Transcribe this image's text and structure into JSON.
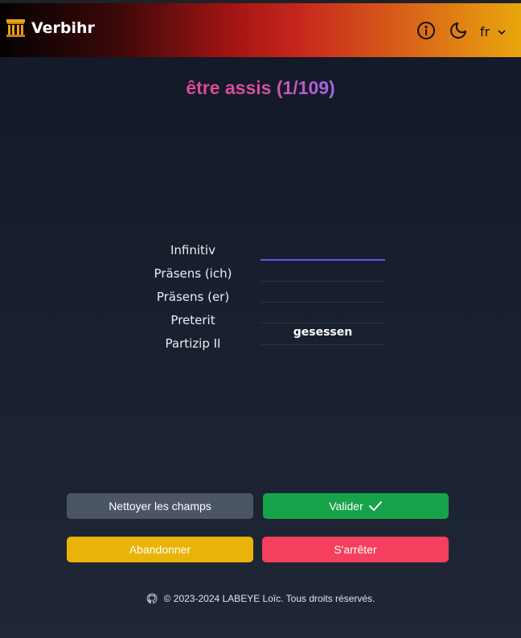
{
  "header": {
    "app_name": "Verbihr",
    "language": "fr",
    "colors": {
      "gradient_start": "#050202",
      "gradient_mid": "#a11414",
      "gradient_end": "#eaa60e"
    },
    "icons": [
      "columns-logo-icon",
      "info-icon",
      "moon-icon",
      "chevron-down-icon"
    ]
  },
  "quiz": {
    "title": "être assis (1/109)",
    "rows": [
      {
        "label": "Infinitiv",
        "value": ""
      },
      {
        "label": "Präsens (ich)",
        "value": ""
      },
      {
        "label": "Präsens (er)",
        "value": ""
      },
      {
        "label": "Preterit",
        "value": ""
      },
      {
        "label": "Partizip II",
        "value": "gesessen"
      }
    ]
  },
  "actions": {
    "clear_label": "Nettoyer les champs",
    "validate_label": "Valider",
    "abandon_label": "Abandonner",
    "stop_label": "S'arrêter",
    "colors": {
      "clear": "#4c5566",
      "validate": "#16a34a",
      "abandon": "#eab308",
      "stop": "#f43f5e"
    }
  },
  "footer": {
    "text": "© 2023-2024 LABEYE Loïc. Tous droits réservés.",
    "icon": "github-icon"
  }
}
